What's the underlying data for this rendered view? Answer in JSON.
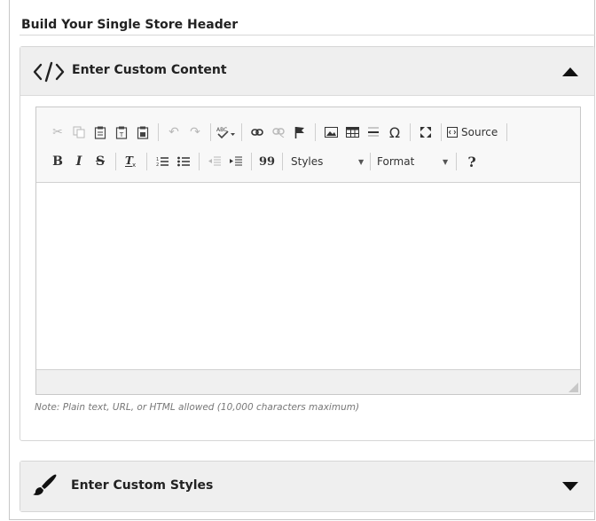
{
  "main_title": "Build Your Single Store Header",
  "panels": [
    {
      "label": "Enter Custom Content",
      "icon": "code-icon",
      "state": "expanded"
    },
    {
      "label": "Enter Custom Styles",
      "icon": "paintbrush-icon",
      "state": "collapsed"
    }
  ],
  "toolbar": {
    "source_label": "Source",
    "styles_label": "Styles",
    "format_label": "Format",
    "help_label": "?",
    "blockquote_label": "99",
    "omega_label": "Ω"
  },
  "editor": {
    "content": ""
  },
  "note": "Note: Plain text, URL, or HTML allowed (10,000 characters maximum)"
}
